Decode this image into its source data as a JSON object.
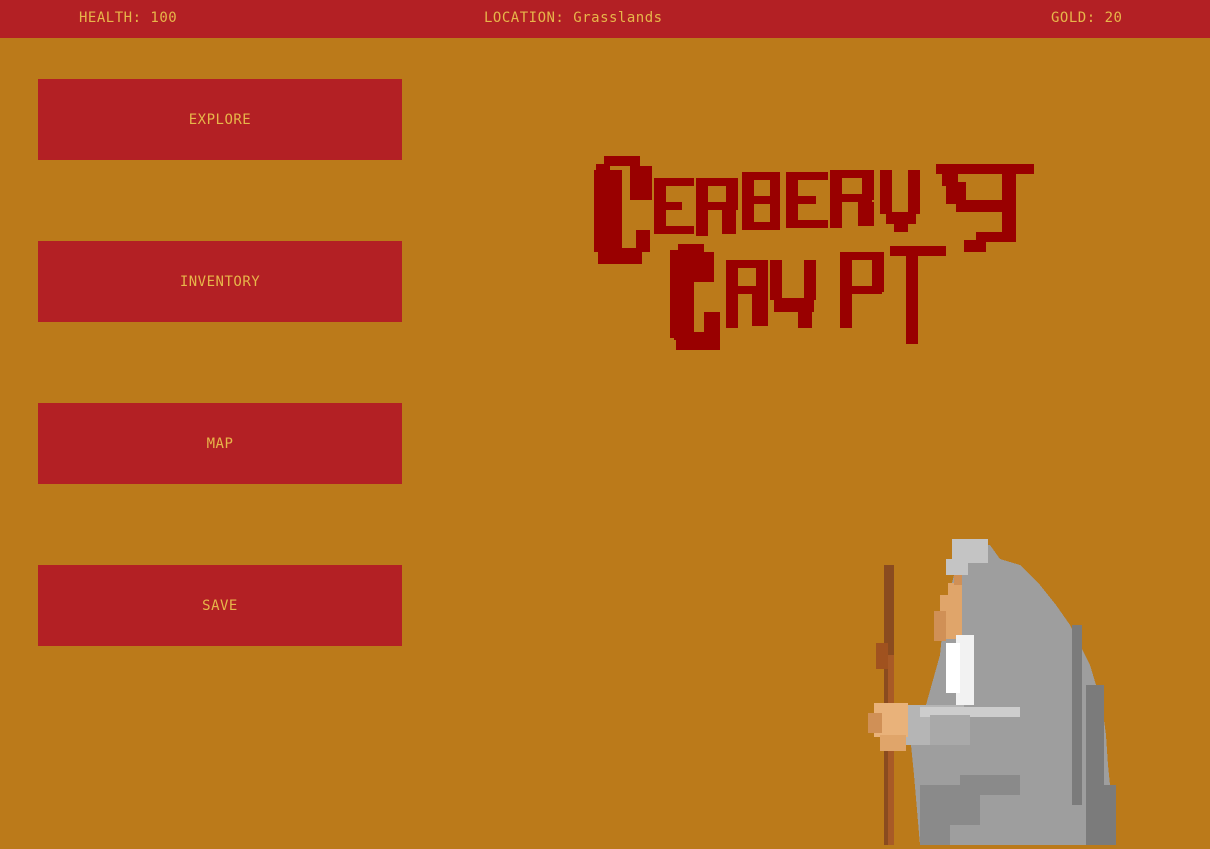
{
  "hud": {
    "health": "HEALTH: 100",
    "location": "LOCATION: Grasslands",
    "gold": "GOLD: 20"
  },
  "menu": {
    "explore": "EXPLORE",
    "inventory": "INVENTORY",
    "map": "MAP",
    "save": "SAVE"
  },
  "logo": {
    "line1": "CERBERVS",
    "line2": "CRYPT"
  },
  "colors": {
    "background": "#bb7a1a",
    "bar": "#b32024",
    "text": "#e7b64a",
    "logo": "#990000"
  },
  "character": "wizard-sprite"
}
